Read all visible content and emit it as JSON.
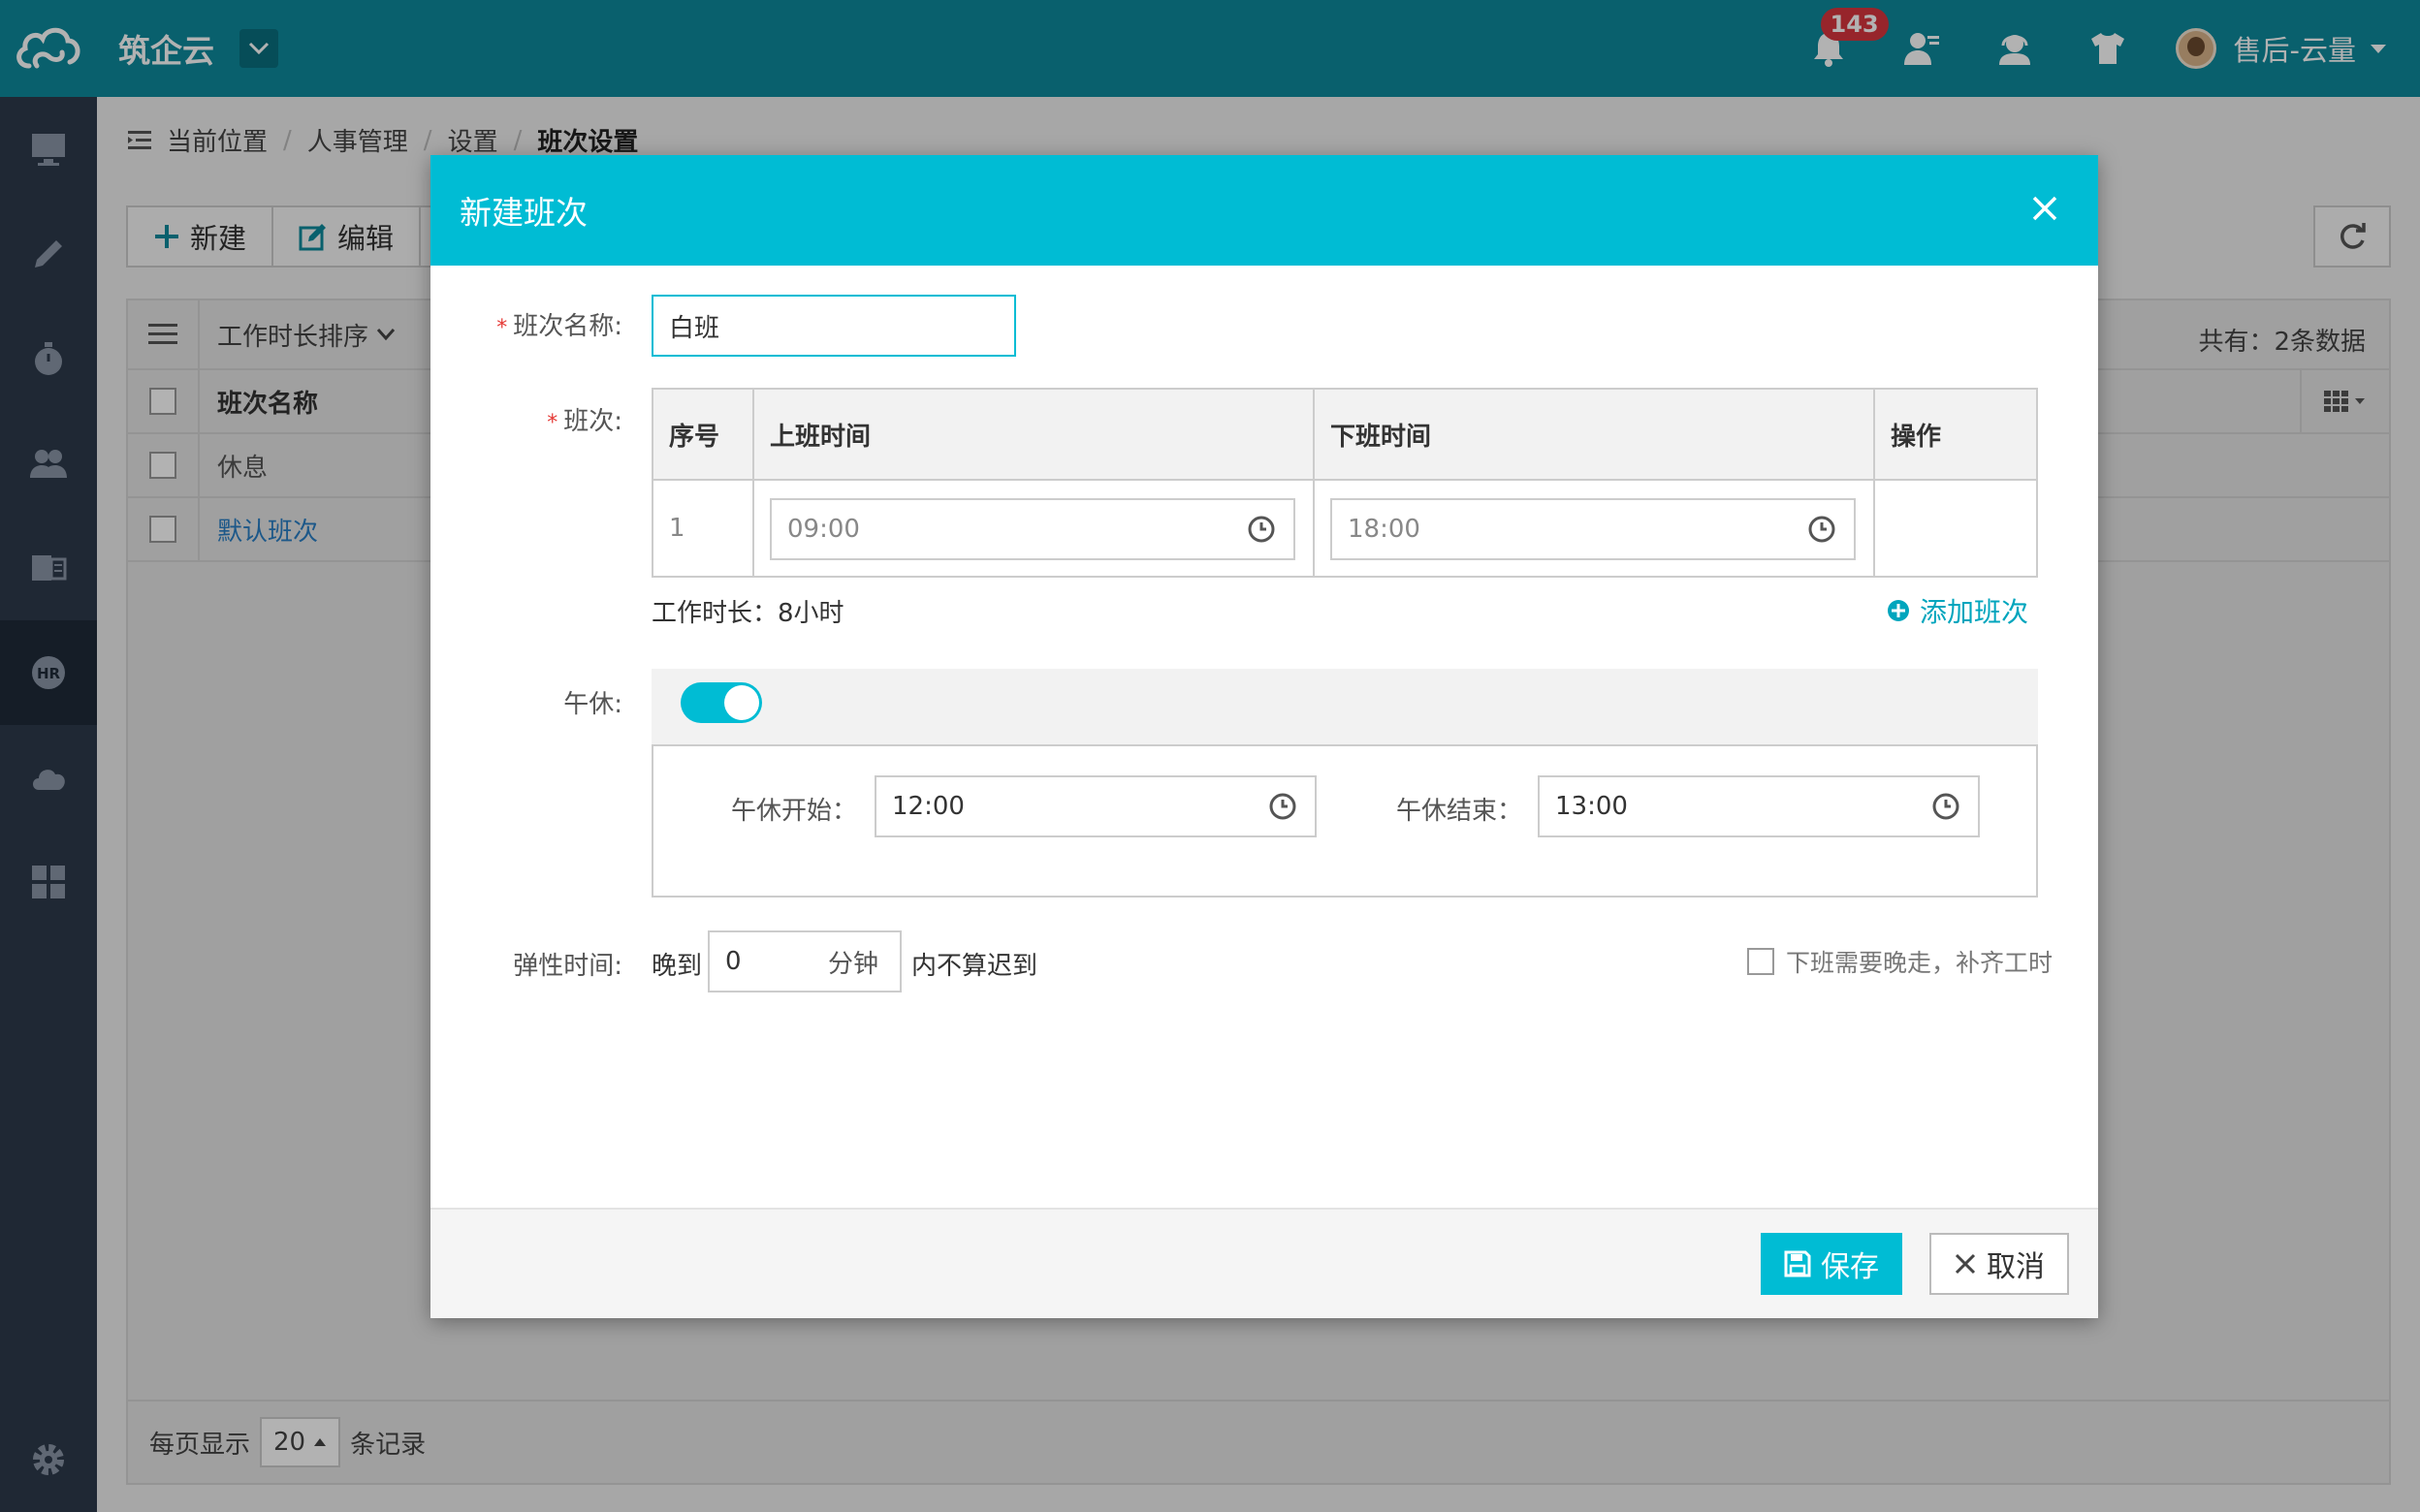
{
  "app": {
    "brand": "筑企云",
    "notification_count": "143",
    "user_name": "售后-云量"
  },
  "breadcrumb": {
    "prefix": "当前位置",
    "items": [
      "人事管理",
      "设置",
      "班次设置"
    ]
  },
  "toolbar": {
    "new_label": "新建",
    "edit_label": "编辑"
  },
  "list": {
    "sort_label": "工作时长排序",
    "total_text": "共有：2条数据",
    "column_header": "班次名称",
    "rows": [
      "休息",
      "默认班次"
    ],
    "page_size_prefix": "每页显示",
    "page_size": "20",
    "page_size_suffix": "条记录"
  },
  "modal": {
    "title": "新建班次",
    "name_label": "班次名称:",
    "name_value": "白班",
    "shift_label": "班次:",
    "table": {
      "headers": [
        "序号",
        "上班时间",
        "下班时间",
        "操作"
      ],
      "row": {
        "index": "1",
        "start": "09:00",
        "end": "18:00"
      }
    },
    "work_duration": "工作时长：8小时",
    "add_shift_label": "添加班次",
    "lunch_label": "午休:",
    "lunch_on": true,
    "lunch_start_label": "午休开始：",
    "lunch_start": "12:00",
    "lunch_end_label": "午休结束：",
    "lunch_end": "13:00",
    "flex_label": "弹性时间:",
    "flex_prefix": "晚到",
    "flex_value": "0",
    "flex_unit": "分钟",
    "flex_suffix": "内不算迟到",
    "makeup_label": "下班需要晚走，补齐工时",
    "save_label": "保存",
    "cancel_label": "取消"
  },
  "colors": {
    "topbar": "#0d8a9c",
    "accent": "#00bcd4",
    "sidebar": "#2d3a4b",
    "badge": "#d9363e",
    "link": "#2a7fc4"
  }
}
